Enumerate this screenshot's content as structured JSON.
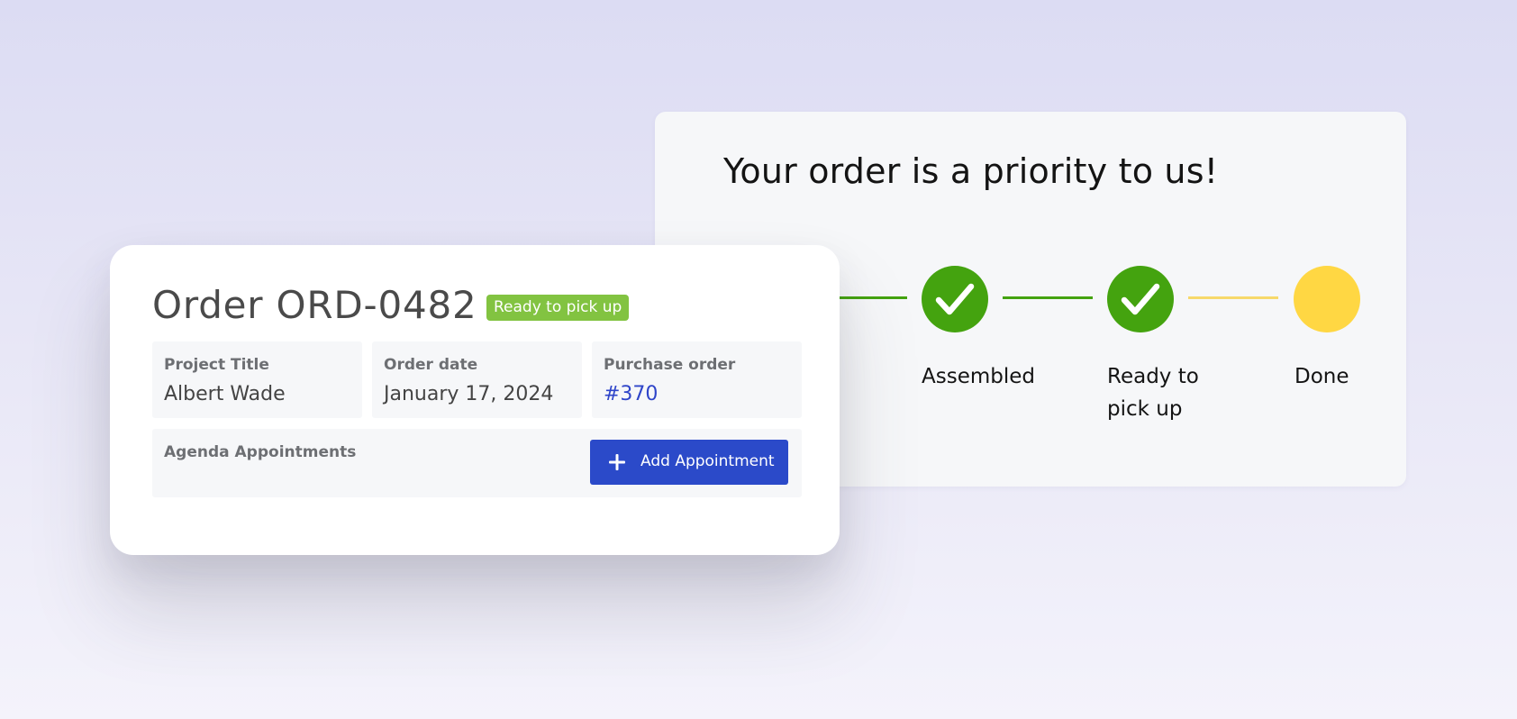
{
  "progress_card": {
    "title": "Your order is a priority to us!",
    "steps": [
      {
        "label": "Assembled",
        "status": "complete"
      },
      {
        "label": "Ready to pick up",
        "status": "complete"
      },
      {
        "label": "Done",
        "status": "pending"
      }
    ],
    "colors": {
      "complete": "#44a30f",
      "pending": "#ffd743",
      "pending_line": "#f7d96b"
    }
  },
  "order_card": {
    "title": "Order ORD-0482",
    "status_badge": "Ready to pick up",
    "fields": [
      {
        "label": "Project Title",
        "value": "Albert Wade"
      },
      {
        "label": "Order date",
        "value": "January 17, 2024"
      },
      {
        "label": "Purchase order",
        "value": "#370"
      }
    ],
    "agenda": {
      "label": "Agenda Appointments",
      "add_button_label": "Add Appointment",
      "add_button_icon": "plus-icon"
    },
    "colors": {
      "badge": "#82c341",
      "primary_button": "#2b4ac9",
      "link": "#2f45c9"
    }
  }
}
